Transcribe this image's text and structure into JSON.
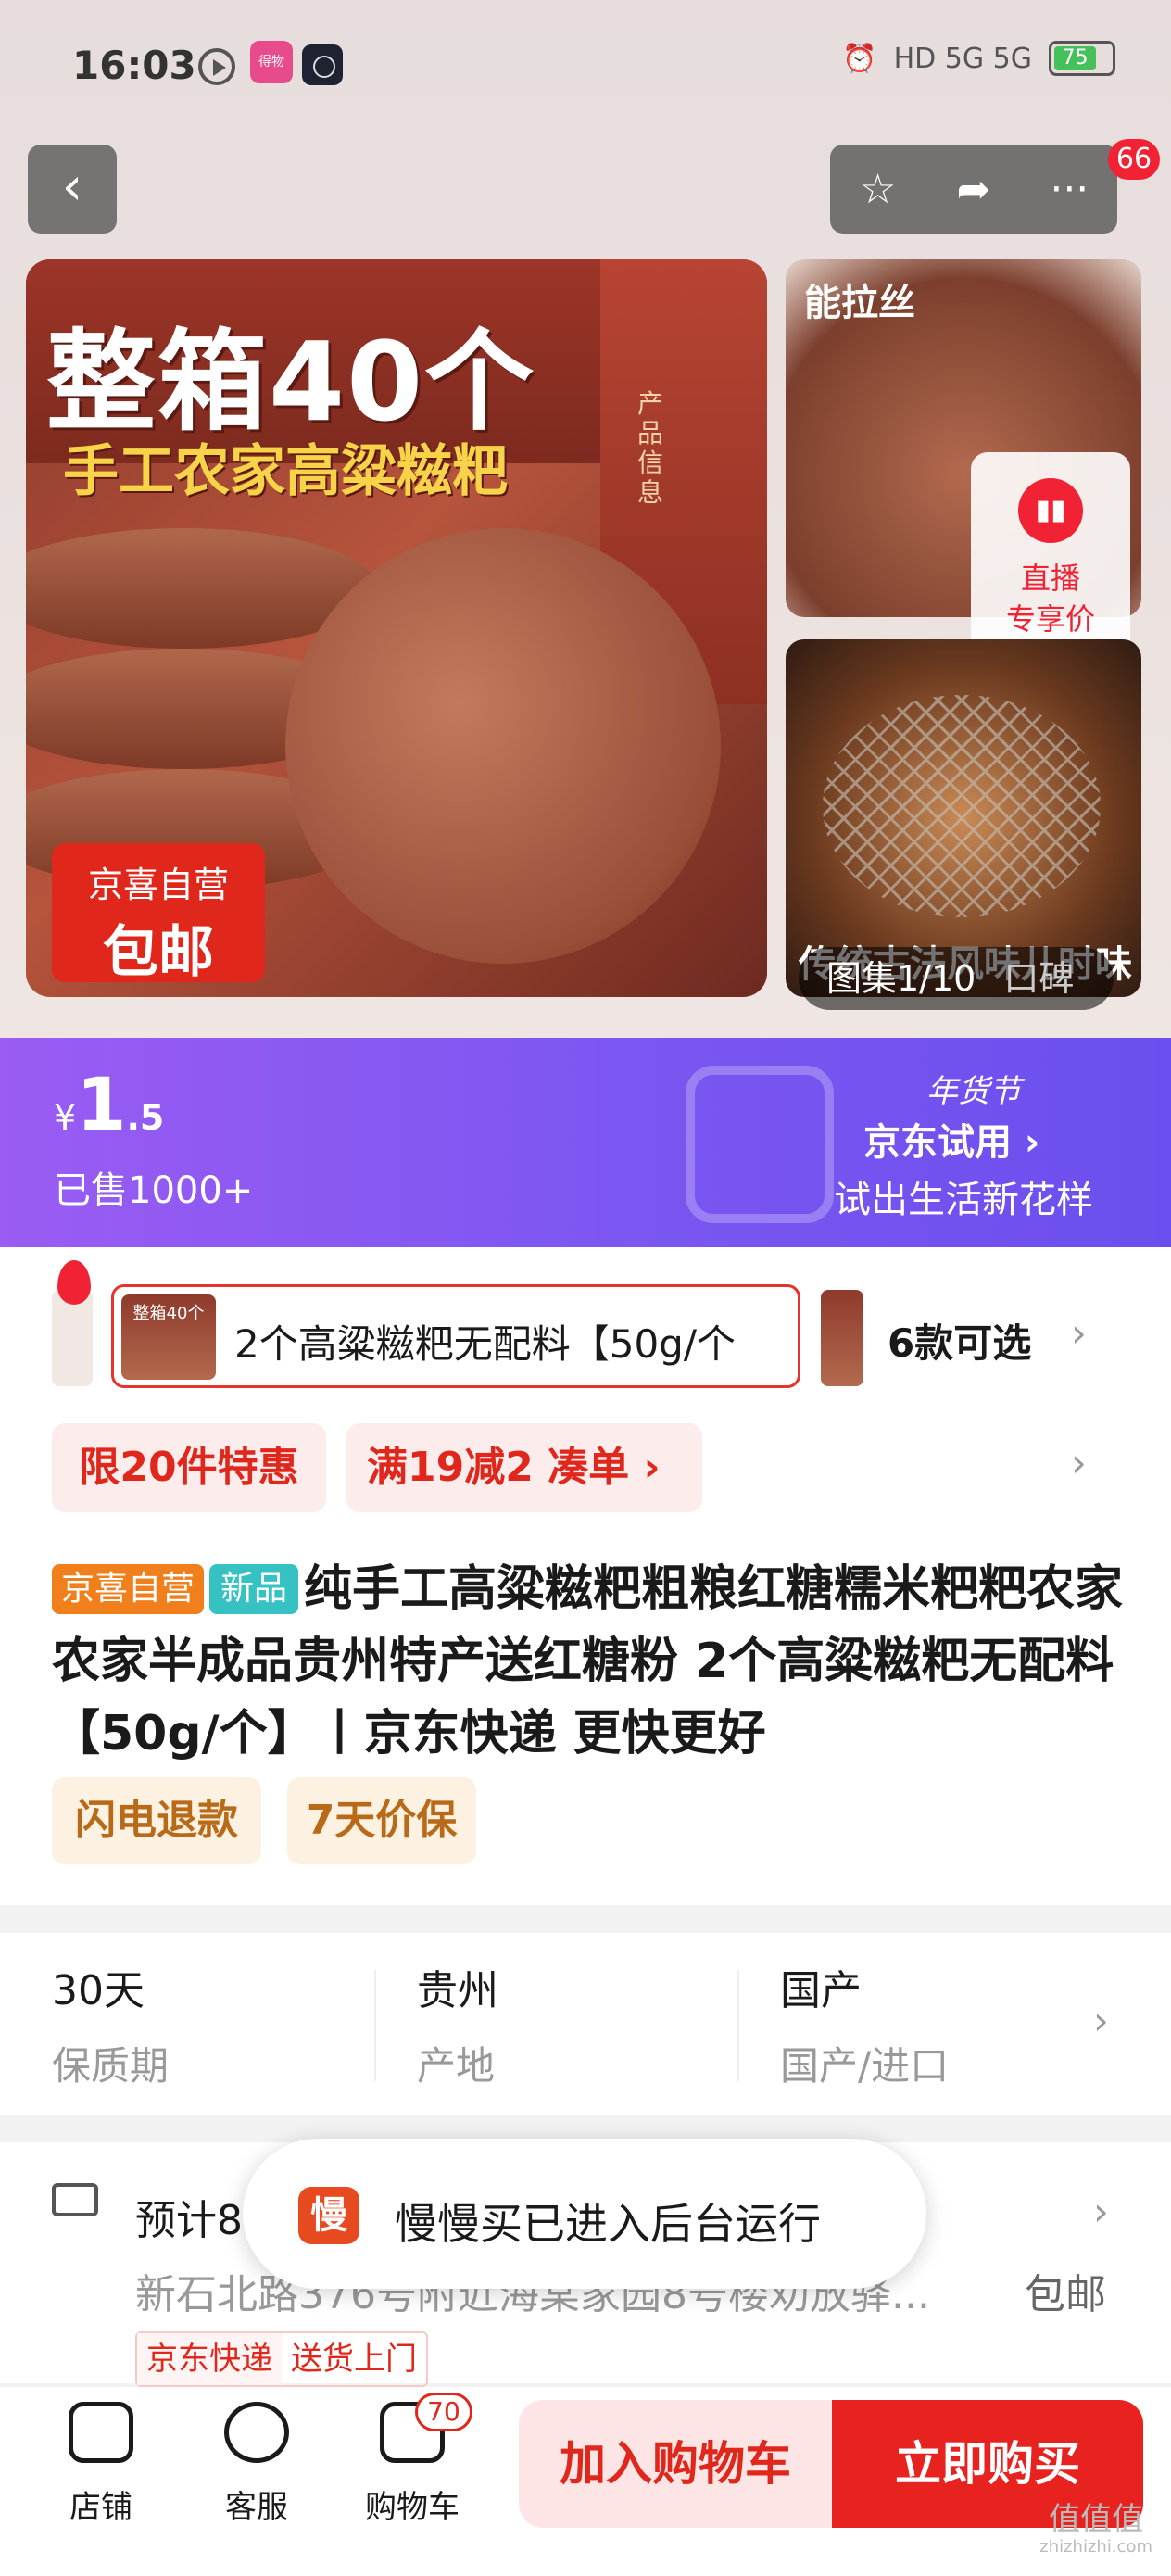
{
  "status_bar": {
    "time": "16:03",
    "app1": "得物",
    "network": "HD 5G 5G",
    "battery": "75"
  },
  "nav": {
    "back": "‹",
    "star": "☆",
    "share": "➦",
    "more": "···",
    "message_badge": "66"
  },
  "gallery": {
    "main_title": "整箱40个",
    "main_subtitle": "手工农家高粱糍粑",
    "box_side_text": "产品信息",
    "badge_top": "京喜自营",
    "badge_bottom": "包邮",
    "side1_tag": "能拉丝",
    "live_icon": "▮▮",
    "live_line1": "直播",
    "live_line2": "专享价",
    "side2_text": "传统古法风味儿时味道",
    "counter": "图集1/10",
    "reviews": "口碑"
  },
  "price": {
    "currency": "¥",
    "integer": "1",
    "decimal": ".5",
    "sold": "已售1000+"
  },
  "promo": {
    "festival": "年货节",
    "title": "京东试用 ›",
    "subtitle": "试出生活新花样"
  },
  "variant": {
    "thumb_text": "整箱40个",
    "selected": "2个高粱糍粑无配料【50g/个",
    "count": "6款可选",
    "chevron": "›"
  },
  "tags": {
    "limit": "限20件特惠",
    "discount": "满19减2 凑单 ›",
    "chevron": "›"
  },
  "product": {
    "badge_jx": "京喜自营",
    "badge_new": "新品",
    "title": "纯手工高粱糍粑粗粮红糖糯米粑粑农家农家半成品贵州特产送红糖粉 2个高粱糍粑无配料【50g/个】丨京东快递 更快更好"
  },
  "services": [
    "闪电退款",
    "7天价保"
  ],
  "attributes": [
    {
      "value": "30天",
      "label": "保质期"
    },
    {
      "value": "贵州",
      "label": "产地"
    },
    {
      "value": "国产",
      "label": "国产/进口"
    }
  ],
  "delivery": {
    "title": "预计8",
    "address": "新石北路376号附近海棠家园8号楼劝放驿...",
    "shipping": "包邮",
    "courier": "京东快递",
    "service": "送货上门",
    "chevron": "›"
  },
  "toast": {
    "icon": "慢",
    "text": "慢慢买已进入后台运行"
  },
  "bottom_bar": {
    "store": "店铺",
    "service": "客服",
    "cart": "购物车",
    "cart_badge": "70",
    "add_to_cart": "加入购物车",
    "buy_now": "立即购买"
  },
  "watermark": {
    "main": "值值值",
    "sub": "zhizhizhi.com"
  }
}
